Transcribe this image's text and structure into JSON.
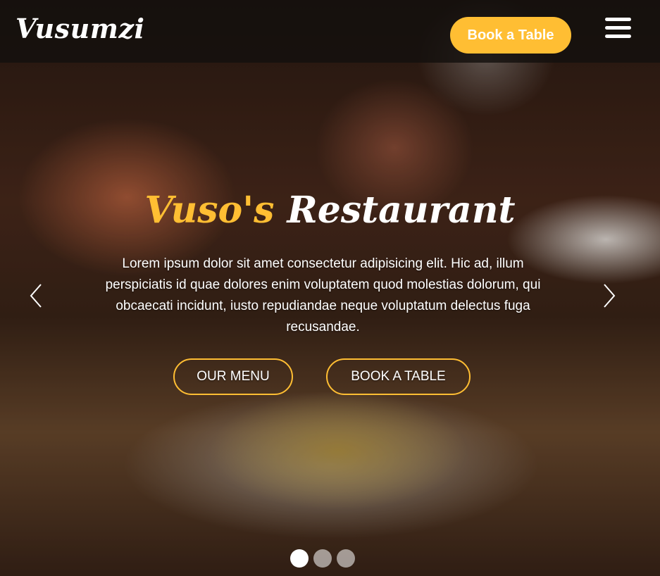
{
  "navbar": {
    "logo": "Vusumzi",
    "book_button": "Book a Table",
    "menu_icon": "hamburger-menu-icon"
  },
  "hero": {
    "title_accent": "Vuso's",
    "title_rest": "Restaurant",
    "description": "Lorem ipsum dolor sit amet consectetur adipisicing elit. Hic ad, illum perspiciatis id quae dolores enim voluptatem quod molestias dolorum, qui obcaecati incidunt, iusto repudiandae neque voluptatum delectus fuga recusandae.",
    "menu_button": "OUR MENU",
    "book_button": "BOOK A TABLE",
    "prev_icon": "chevron-left-icon",
    "next_icon": "chevron-right-icon"
  },
  "carousel": {
    "slide_count": 3,
    "active_index": 0
  },
  "colors": {
    "accent": "#ffbe33",
    "navbar_bg": "#14100e",
    "text": "#ffffff"
  }
}
